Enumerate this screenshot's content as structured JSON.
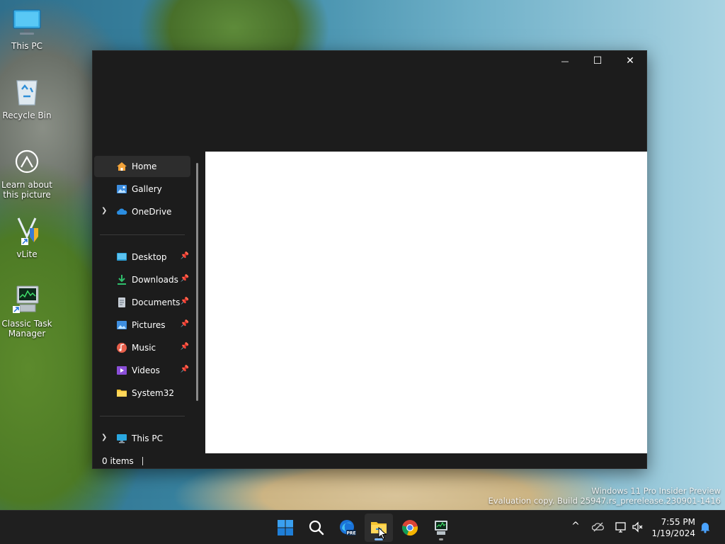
{
  "desktop": {
    "icons": [
      {
        "label": "This PC",
        "icon": "monitor-icon"
      },
      {
        "label": "Recycle Bin",
        "icon": "recycle-bin-icon"
      },
      {
        "label": "Learn about this picture",
        "icon": "camera-info-icon"
      },
      {
        "label": "vLite",
        "icon": "vlite-icon"
      },
      {
        "label": "Classic Task Manager",
        "icon": "task-manager-icon"
      }
    ],
    "watermark": {
      "line1": "Windows 11 Pro Insider Preview",
      "line2": "Evaluation copy. Build 25947.rs_prerelease.230901-1416"
    }
  },
  "explorer": {
    "caption": {
      "minimize": "—",
      "maximize": "☐",
      "close": "✕"
    },
    "nav": {
      "home": "Home",
      "gallery": "Gallery",
      "onedrive": "OneDrive",
      "desktop": "Desktop",
      "downloads": "Downloads",
      "documents": "Documents",
      "pictures": "Pictures",
      "music": "Music",
      "videos": "Videos",
      "system32": "System32",
      "this_pc": "This PC"
    },
    "status": {
      "items": "0 items"
    }
  },
  "taskbar": {
    "apps": [
      "start-icon",
      "search-icon",
      "edge-preview-icon",
      "file-explorer-icon",
      "chrome-icon",
      "task-manager-icon"
    ],
    "clock": {
      "time": "7:55 PM",
      "date": "1/19/2024"
    }
  },
  "colors": {
    "window_bg": "#1c1c1c",
    "selected": "#2d2d2d",
    "taskbar": "#1f1f1f",
    "accent": "#0078d4"
  }
}
